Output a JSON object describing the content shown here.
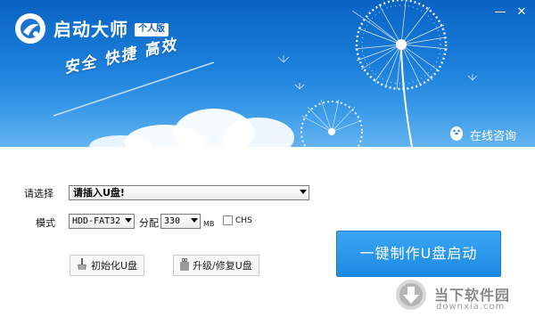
{
  "app": {
    "title": "启动大师",
    "edition": "个人版",
    "slogan": "安全 快捷 高效"
  },
  "window_controls": {
    "minimize": "—",
    "close": "✕"
  },
  "consult": {
    "label": "在线咨询",
    "icon": "penguin-chat-icon"
  },
  "form": {
    "select_label": "请选择",
    "drive_select_value": "请插入U盘!",
    "mode_label": "模式",
    "mode_value": "HDD-FAT32",
    "alloc_label": "分配",
    "alloc_value": "330",
    "alloc_unit": "MB",
    "chs_label": "CHS",
    "chs_checked": false
  },
  "buttons": {
    "init_usb": "初始化U盘",
    "upgrade_repair": "升级/修复U盘",
    "make_boot": "一键制作U盘启动"
  },
  "watermark": {
    "name": "当下软件园",
    "url": "downxia.com"
  },
  "colors": {
    "banner_top": "#0a63c4",
    "banner_bottom": "#64b4f0",
    "primary_button": "#2a98ea"
  }
}
